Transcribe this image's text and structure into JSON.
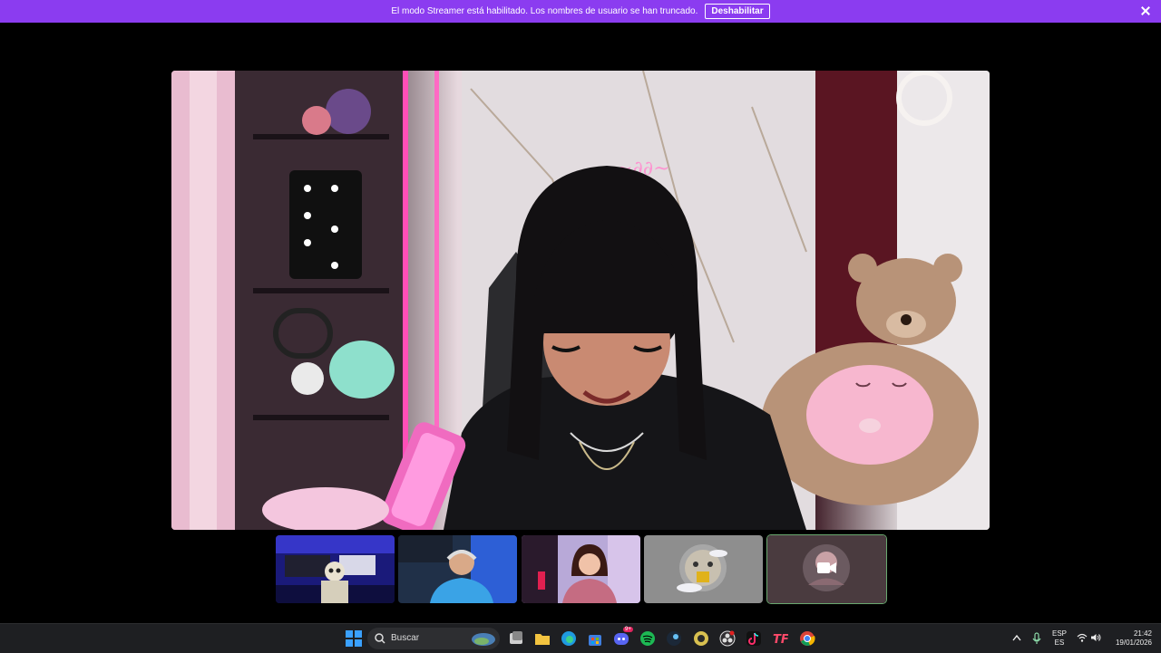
{
  "banner": {
    "message": "El modo Streamer está habilitado. Los nombres de usuario se han truncado.",
    "button_label": "Deshabilitar",
    "color": "#8b3cf0"
  },
  "participants": [
    {
      "id": "tile-1",
      "kind": "video",
      "scene": "skeleton-setup"
    },
    {
      "id": "tile-2",
      "kind": "video",
      "scene": "boy-headphones"
    },
    {
      "id": "tile-3",
      "kind": "video",
      "scene": "girl-plaid"
    },
    {
      "id": "tile-4",
      "kind": "avatar",
      "scene": "bear-avatar"
    },
    {
      "id": "tile-5",
      "kind": "camera-off",
      "scene": "avatar-camera-icon"
    }
  ],
  "taskbar": {
    "search_label": "Buscar",
    "icons": [
      "windows-start-icon",
      "search-icon",
      "widgets-icon",
      "task-view-icon",
      "file-explorer-icon",
      "edge-icon",
      "store-icon",
      "discord-icon",
      "spotify-icon",
      "steam-icon",
      "app-icon",
      "obs-icon",
      "tiktok-icon",
      "tf-icon",
      "chrome-icon"
    ],
    "discord_badge": "9+",
    "lang_top": "ESP",
    "lang_bottom": "ES",
    "time": "21:42",
    "date": "19/01/2026"
  }
}
